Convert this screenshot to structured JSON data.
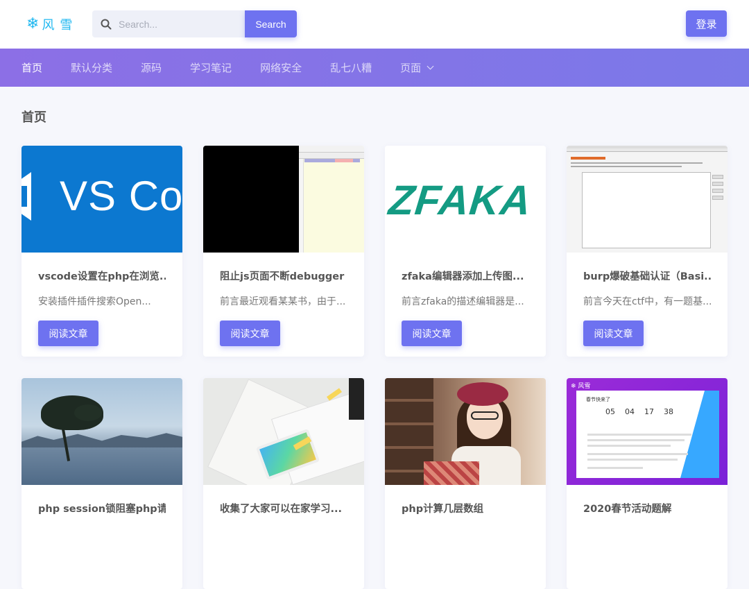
{
  "brand": {
    "logo_icon": "snowflake-icon",
    "logo_text": "风雪",
    "accent": "#6e72f0"
  },
  "search": {
    "placeholder": "Search...",
    "button_label": "Search"
  },
  "header": {
    "login_label": "登录"
  },
  "nav": {
    "items": [
      {
        "label": "首页",
        "active": true
      },
      {
        "label": "默认分类"
      },
      {
        "label": "源码"
      },
      {
        "label": "学习笔记"
      },
      {
        "label": "网络安全"
      },
      {
        "label": "乱七八糟"
      },
      {
        "label": "页面",
        "has_dropdown": true
      }
    ]
  },
  "page": {
    "title": "首页"
  },
  "posts": [
    {
      "title": "vscode设置在php在浏览...",
      "excerpt": "安装插件插件搜索Open...",
      "button": "阅读文章",
      "thumb_text": "VS Co"
    },
    {
      "title": "阻止js页面不断debugger",
      "excerpt": "前言最近观看某某书，由于...",
      "button": "阅读文章"
    },
    {
      "title": "zfaka编辑器添加上传图...",
      "excerpt": "前言zfaka的描述编辑器是...",
      "button": "阅读文章",
      "thumb_text": "ZFAKA"
    },
    {
      "title": "burp爆破基础认证（Basi...",
      "excerpt": "前言今天在ctf中，有一题基...",
      "button": "阅读文章"
    },
    {
      "title": "php session锁阻塞php请..."
    },
    {
      "title": "收集了大家可以在家学习..."
    },
    {
      "title": "php计算几层数组"
    },
    {
      "title": "2020春节活动题解",
      "thumb_heading": "春节快来了",
      "thumb_countdown": [
        "05",
        "04",
        "17",
        "38"
      ],
      "thumb_logo": "❄ 风雪"
    }
  ]
}
